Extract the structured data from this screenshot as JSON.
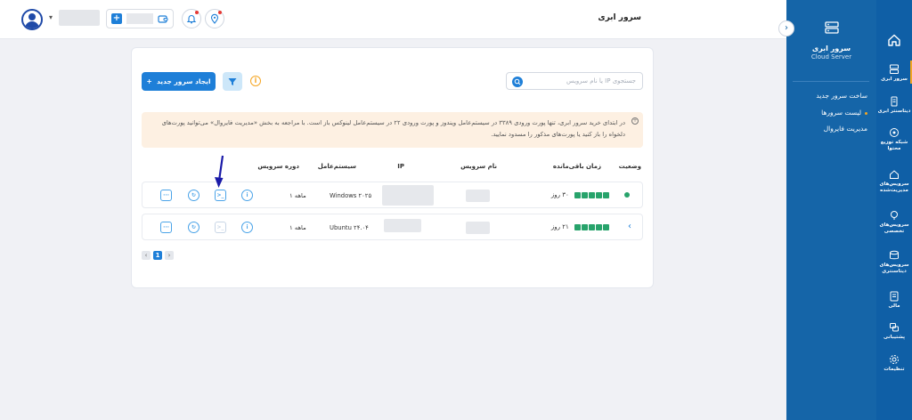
{
  "header": {
    "page_title": "سرور ابری",
    "collapse_glyph": "›"
  },
  "sidebar": {
    "brand_fa": "سرور ابری",
    "brand_en": "Cloud Server",
    "submenu": [
      {
        "label": "ساخت سرور جدید",
        "bullet": false
      },
      {
        "label": "لیست سرورها",
        "bullet": true
      },
      {
        "label": "مدیریت فایروال",
        "bullet": false
      }
    ],
    "items": [
      {
        "label": "سرور ابری",
        "icon": "server-icon",
        "active": true
      },
      {
        "label": "دیتاسنتر ابری",
        "icon": "datacenter-icon",
        "active": false
      },
      {
        "label": "شبکه توزیع محتوا",
        "icon": "cdn-icon",
        "active": false
      },
      {
        "label": "سرویس‌های مدیریت‌شده",
        "icon": "managed-services-icon",
        "active": false
      },
      {
        "label": "سرویس‌های تخصصی",
        "icon": "special-services-icon",
        "active": false
      },
      {
        "label": "سرویس‌های دیتاسنتری",
        "icon": "datacenter-services-icon",
        "active": false
      },
      {
        "label": "مالی",
        "icon": "finance-icon",
        "active": false
      },
      {
        "label": "پشتیبانی",
        "icon": "support-icon",
        "active": false
      },
      {
        "label": "تنظیمات",
        "icon": "settings-icon",
        "active": false
      }
    ]
  },
  "toolbar": {
    "search_placeholder": "جستجوی IP یا نام سرویس",
    "create_label": "ایجاد سرور جدید",
    "create_plus": "+",
    "info_glyph": "i"
  },
  "notice": {
    "icon_glyph": "+",
    "text": "در ابتدای خرید سرور ابری، تنها پورت ورودی ۳۳۸۹ در سیستم‌عامل ویندوز و پورت ورودی ۲۲ در سیستم‌عامل لینوکس باز است. با مراجعه به بخش «مدیریت فایروال» می‌توانید پورت‌های دلخواه را باز کنید یا پورت‌های مذکور را مسدود نمایید."
  },
  "table": {
    "headers": {
      "status": "وضعیت",
      "remaining": "زمان باقی‌مانده",
      "service_name": "نام سرویس",
      "ip": "IP",
      "os": "سیستم‌عامل",
      "period": "دوره سرویس"
    },
    "rows": [
      {
        "remaining": "۳۰ روز",
        "remaining_blocks": 5,
        "os": "Windows ۲۰۲۵",
        "period": "۱ ماهه",
        "status_glyph": "●"
      },
      {
        "remaining": "۲۱ روز",
        "remaining_blocks": 5,
        "os": "Ubuntu ۲۴.۰۴",
        "period": "۱ ماهه",
        "status_glyph": "‹"
      }
    ],
    "action_glyphs": {
      "info": "i",
      "console": "&gt;_",
      "restart": "↻",
      "more": "···"
    }
  },
  "pagination": {
    "prev": "‹",
    "current": "1",
    "next": "›"
  },
  "colors": {
    "accent": "#1e7fd8",
    "sidebar_dark": "#0f5fa6",
    "sidebar_mid": "#1565a8",
    "active_marker": "#f5a623",
    "status_green": "#27a36b",
    "notice_bg": "#fdf0e2",
    "annotation_arrow": "#1a1aa8"
  }
}
